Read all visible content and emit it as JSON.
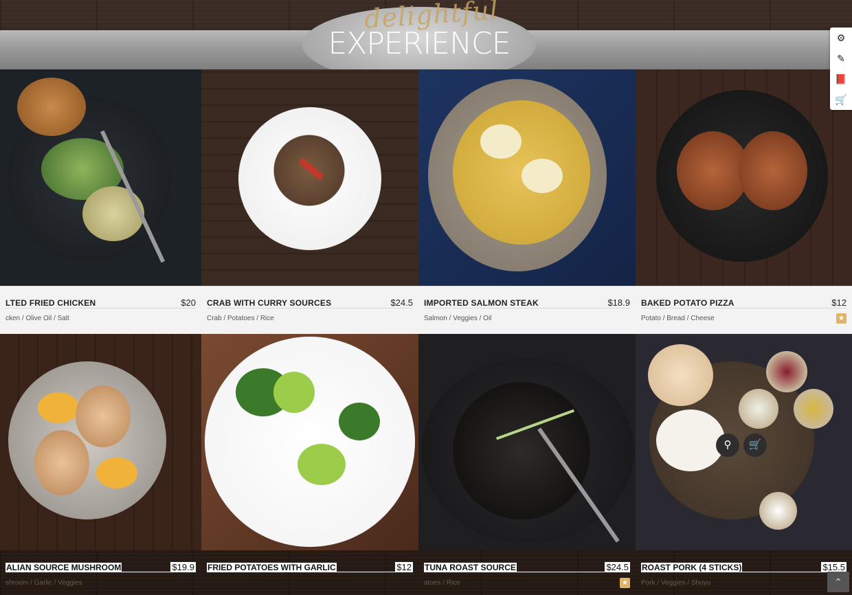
{
  "header": {
    "script_text": "delightful",
    "title": "EXPERIENCE"
  },
  "menu_items": [
    {
      "name": "LTED FRIED CHICKEN",
      "price": "$20",
      "ingredients": "cken / Olive Oil / Salt"
    },
    {
      "name": "CRAB WITH CURRY SOURCES",
      "price": "$24.5",
      "ingredients": "Crab / Potatoes / Rice"
    },
    {
      "name": "IMPORTED SALMON STEAK",
      "price": "$18.9",
      "ingredients": "Salmon / Veggies / Oil"
    },
    {
      "name": "BAKED POTATO PIZZA",
      "price": "$12",
      "ingredients": "Potato / Bread / Cheese"
    },
    {
      "name": "ALIAN SOURCE MUSHROOM",
      "price": "$19.9",
      "ingredients": "shroom / Garlic / Veggies"
    },
    {
      "name": "FRIED POTATOES WITH GARLIC",
      "price": "$12",
      "ingredients": ""
    },
    {
      "name": "TUNA ROAST SOURCE",
      "price": "$24.5",
      "ingredients": "atoes / Rice"
    },
    {
      "name": "ROAST PORK (4 STICKS)",
      "price": "$15.5",
      "ingredients": "Pork / Veggies / Shoyu"
    }
  ],
  "icons": {
    "favorite": "star-icon",
    "quick_view": "search-icon",
    "add_to_cart": "cart-icon",
    "settings": "gear-icon",
    "edit": "edit-icon",
    "docs": "book-icon",
    "shop": "basket-icon",
    "back_to_top": "chevron-up-icon"
  },
  "colors": {
    "accent_gold": "#e0b36b",
    "script_gold": "#c9a463"
  }
}
